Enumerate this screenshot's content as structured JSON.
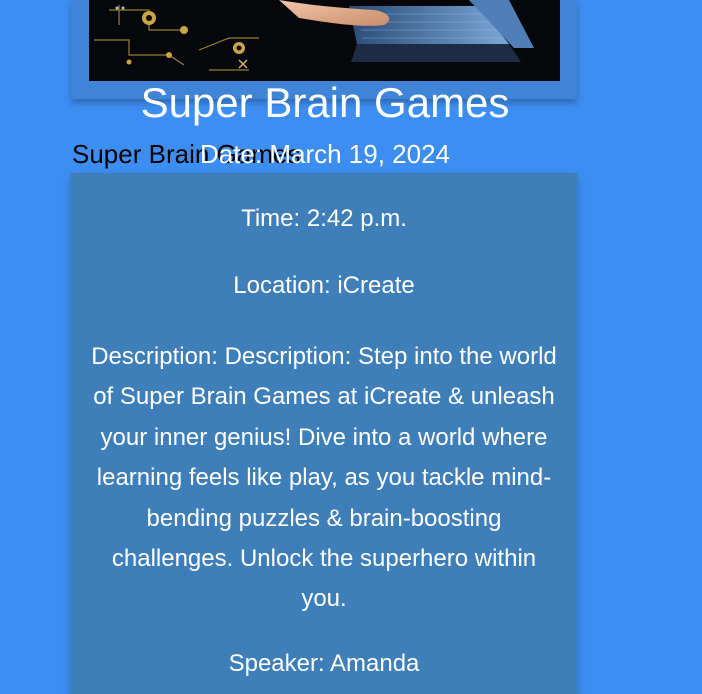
{
  "event": {
    "title": "Super Brain Games",
    "image_alt": "Super Brain Games",
    "date": "Date: March 19, 2024",
    "time": "Time: 2:42 p.m.",
    "location": "Location: iCreate",
    "description": "Description: Description: Step into the world of Super Brain Games at iCreate & unleash your inner genius! Dive into a world where learning feels like play, as you tackle mind-bending puzzles & brain-boosting challenges. Unlock the superhero within you.",
    "speaker": "Speaker: Amanda"
  },
  "colors": {
    "page_background": "#3d8ef2",
    "card_background": "#3f7fb9",
    "text": "#ffffff"
  }
}
